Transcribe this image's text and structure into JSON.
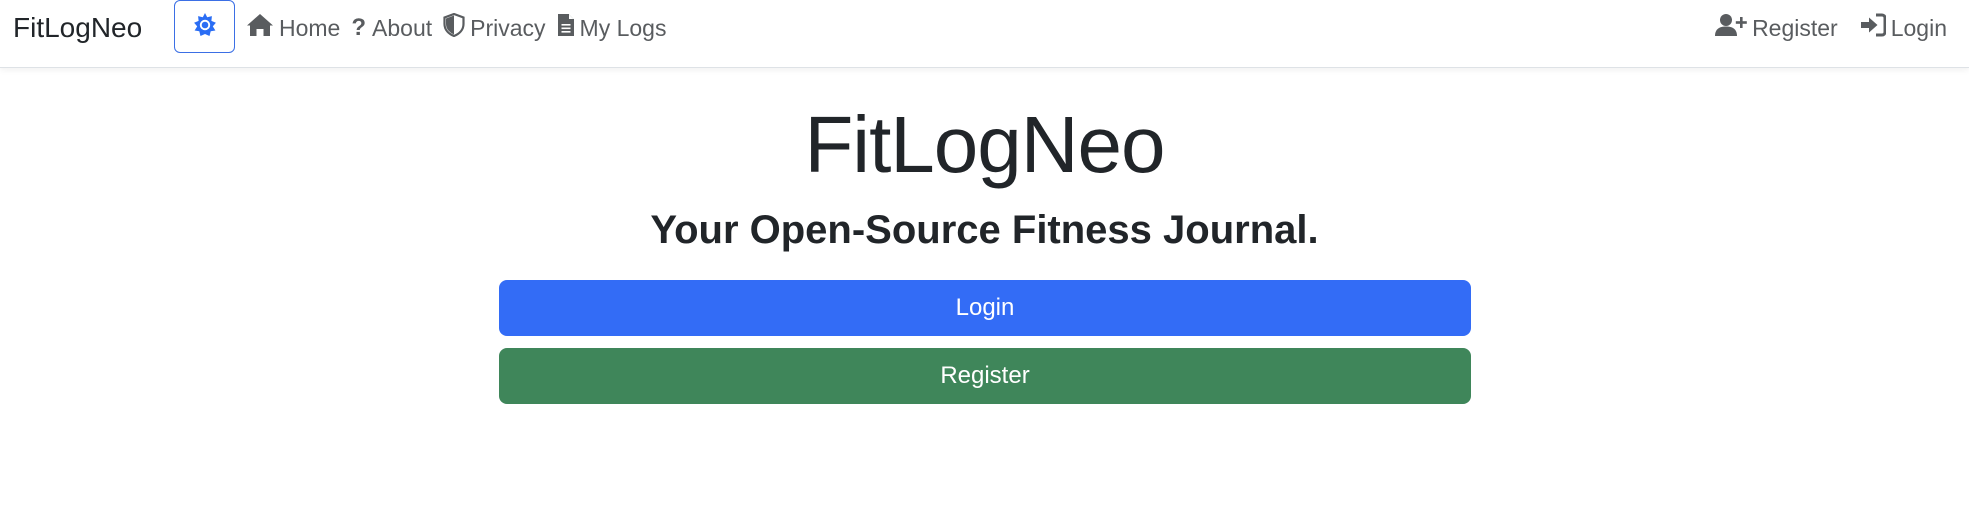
{
  "navbar": {
    "brand": "FitLogNeo",
    "theme_toggle_icon": "gear-icon",
    "left_links": [
      {
        "label": "Home",
        "icon": "home-icon"
      },
      {
        "label": "About",
        "icon": "question-icon"
      },
      {
        "label": "Privacy",
        "icon": "shield-icon"
      },
      {
        "label": "My Logs",
        "icon": "document-icon"
      }
    ],
    "right_links": [
      {
        "label": "Register",
        "icon": "user-plus-icon"
      },
      {
        "label": "Login",
        "icon": "sign-in-icon"
      }
    ],
    "question_glyph": "?"
  },
  "hero": {
    "title": "FitLogNeo",
    "subtitle": "Your Open-Source Fitness Journal.",
    "login_label": "Login",
    "register_label": "Register"
  },
  "colors": {
    "primary": "#336cf6",
    "success": "#3f865a",
    "text": "#212529",
    "nav_text": "#595c5f"
  }
}
